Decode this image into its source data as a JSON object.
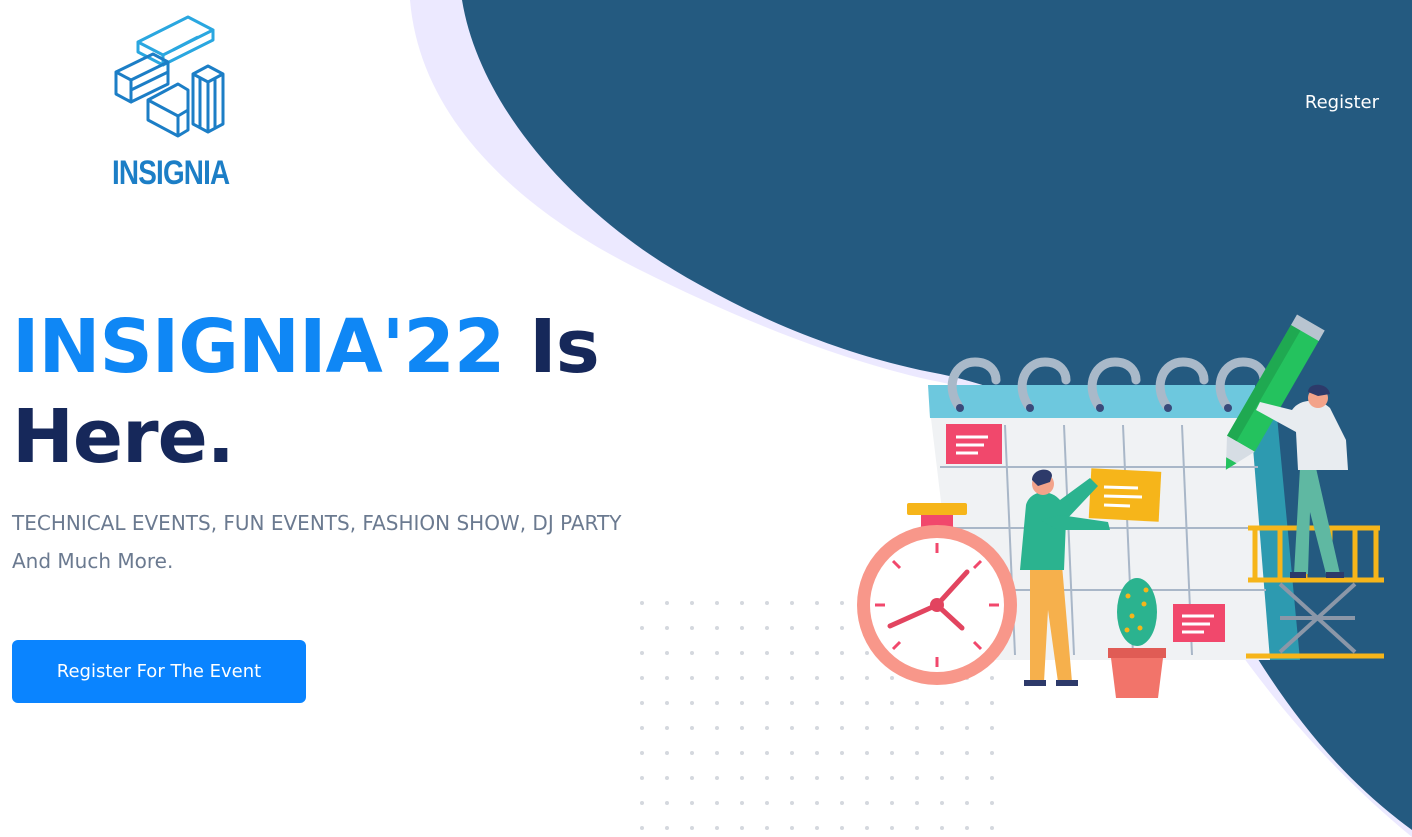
{
  "logo": {
    "text": "INSIGNIA",
    "icon": "insignia-cube-logo"
  },
  "nav": {
    "register_label": "Register"
  },
  "hero": {
    "title_accent": "INSIGNIA'22",
    "title_rest_1": " Is",
    "title_rest_2": "Here.",
    "subtitle": "TECHNICAL EVENTS, FUN EVENTS, FASHION SHOW, DJ PARTY And Much More.",
    "cta_label": "Register For The Event"
  },
  "illustration": {
    "name": "calendar-scheduling-illustration"
  },
  "colors": {
    "background": "#ffffff",
    "blob": "#245a80",
    "blob_shadow": "#ece9ff",
    "accent": "#0f87f5",
    "title_dark": "#16285a",
    "subtitle": "#6b7a90",
    "button": "#0a84ff"
  }
}
